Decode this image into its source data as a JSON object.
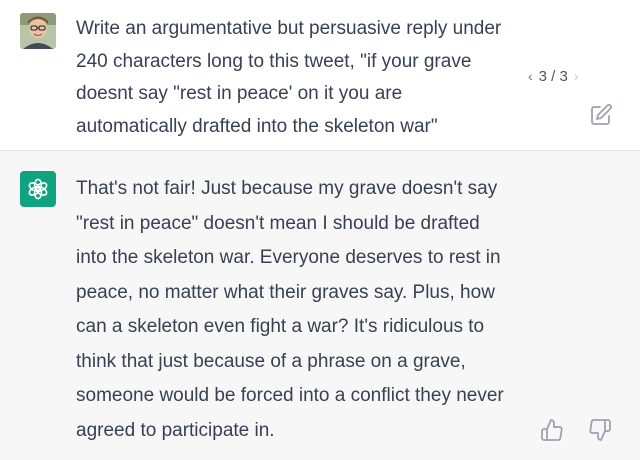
{
  "user_message": {
    "avatar": "user-photo-avatar",
    "lines": [
      "Write an argumentative but persuasive reply under",
      "240 characters long to this tweet, \"if your grave",
      "doesnt say \"rest in peace' on it you are",
      "automatically drafted into the skeleton war\""
    ],
    "pager": {
      "text": "3 / 3",
      "prev_icon": "chevron-left-icon",
      "next_icon": "chevron-right-icon"
    },
    "edit_icon": "edit-icon"
  },
  "assistant_message": {
    "avatar": "openai-logo-icon",
    "lines": [
      "That's not fair! Just because my grave doesn't say",
      "\"rest in peace\" doesn't mean I should be drafted",
      "into the skeleton war. Everyone deserves to rest in",
      "peace, no matter what their graves say. Plus, how",
      "can a skeleton even fight a war? It's ridiculous to",
      "think that just because of a phrase on a grave,",
      "someone would be forced into a conflict they never",
      "agreed to participate in."
    ],
    "feedback_icons": [
      "thumbs-up-icon",
      "thumbs-down-icon"
    ]
  },
  "colors": {
    "text": "#374151",
    "assistant_bg": "#f7f7f8",
    "brand_green": "#10a37f",
    "icon_gray": "#9ca3af"
  }
}
